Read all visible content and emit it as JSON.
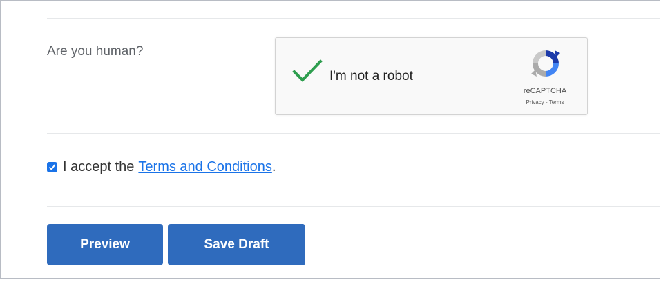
{
  "form": {
    "human_label": "Are you human?",
    "recaptcha": {
      "checkbox_label": "I'm not a robot",
      "checked": true,
      "brand": "reCAPTCHA",
      "legal": "Privacy - Terms",
      "check_color": "#2e9e4f"
    },
    "terms": {
      "checked": true,
      "prefix": "I accept the",
      "link_text": "Terms and Conditions",
      "suffix": "."
    },
    "buttons": {
      "preview": "Preview",
      "save_draft": "Save Draft"
    }
  },
  "colors": {
    "accent": "#2f6bbd",
    "link": "#1a73e8"
  }
}
